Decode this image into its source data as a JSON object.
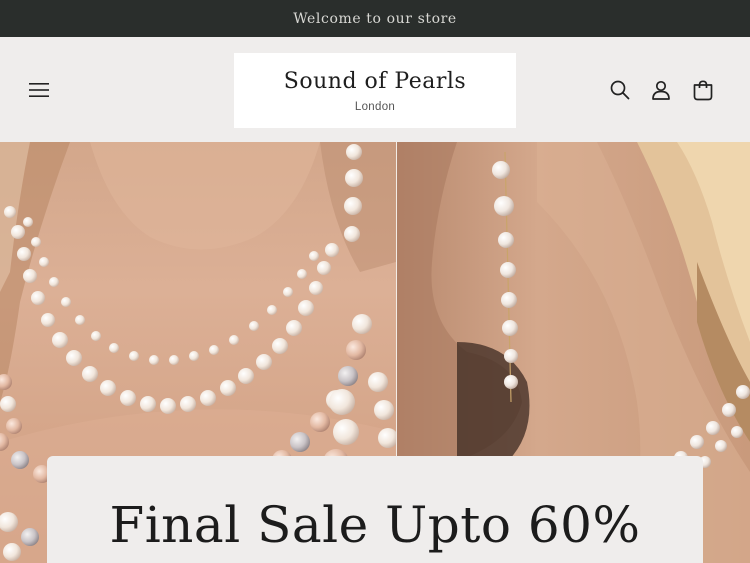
{
  "announcement": {
    "text": "Welcome to our store"
  },
  "header": {
    "logo": {
      "name": "Sound of Pearls",
      "city": "London"
    },
    "icons": [
      "menu-icon",
      "search-icon",
      "account-icon",
      "cart-icon"
    ]
  },
  "hero": {
    "images": [
      "pearl-necklace-image",
      "pearl-drop-earring-image"
    ],
    "sale_title": "Final Sale Upto 60%"
  },
  "colors": {
    "announcement_bg": "#2a2e2c",
    "header_bg": "#efedec",
    "logo_bg": "#ffffff",
    "text": "#1f1f1f"
  }
}
